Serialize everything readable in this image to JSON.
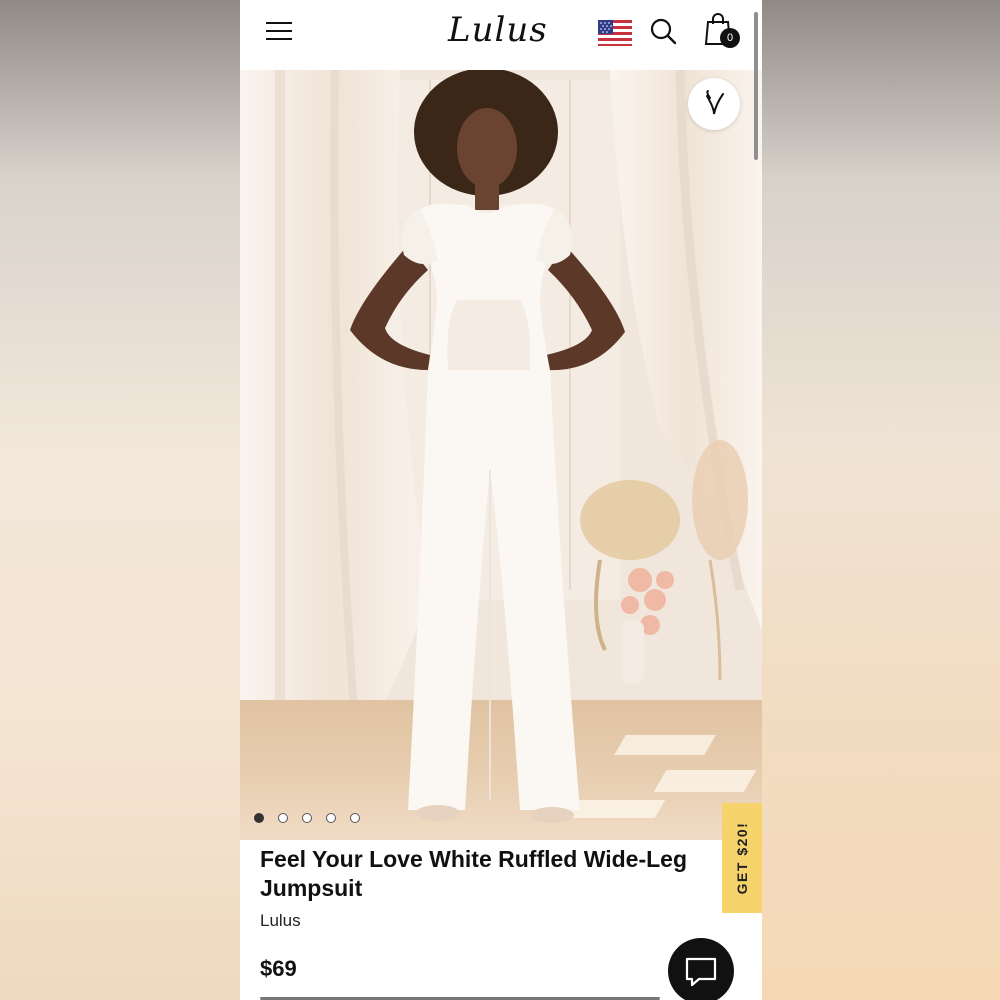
{
  "header": {
    "logo_text": "Lulus",
    "menu_icon": "hamburger-menu-icon",
    "flag_icon": "us-flag-icon",
    "search_icon": "search-icon",
    "cart_icon": "shopping-bag-icon",
    "cart_count": "0"
  },
  "gallery": {
    "favorite_icon": "heart-icon",
    "slide_count": 5,
    "active_slide": 1
  },
  "promo": {
    "label": "GET $20!",
    "color": "#f6d36b"
  },
  "product": {
    "title": "Feel Your Love White Ruffled Wide-Leg Jumpsuit",
    "brand": "Lulus",
    "price": "$69"
  },
  "chat": {
    "icon": "chat-bubble-icon"
  },
  "colors": {
    "text": "#111111",
    "background": "#ffffff"
  }
}
